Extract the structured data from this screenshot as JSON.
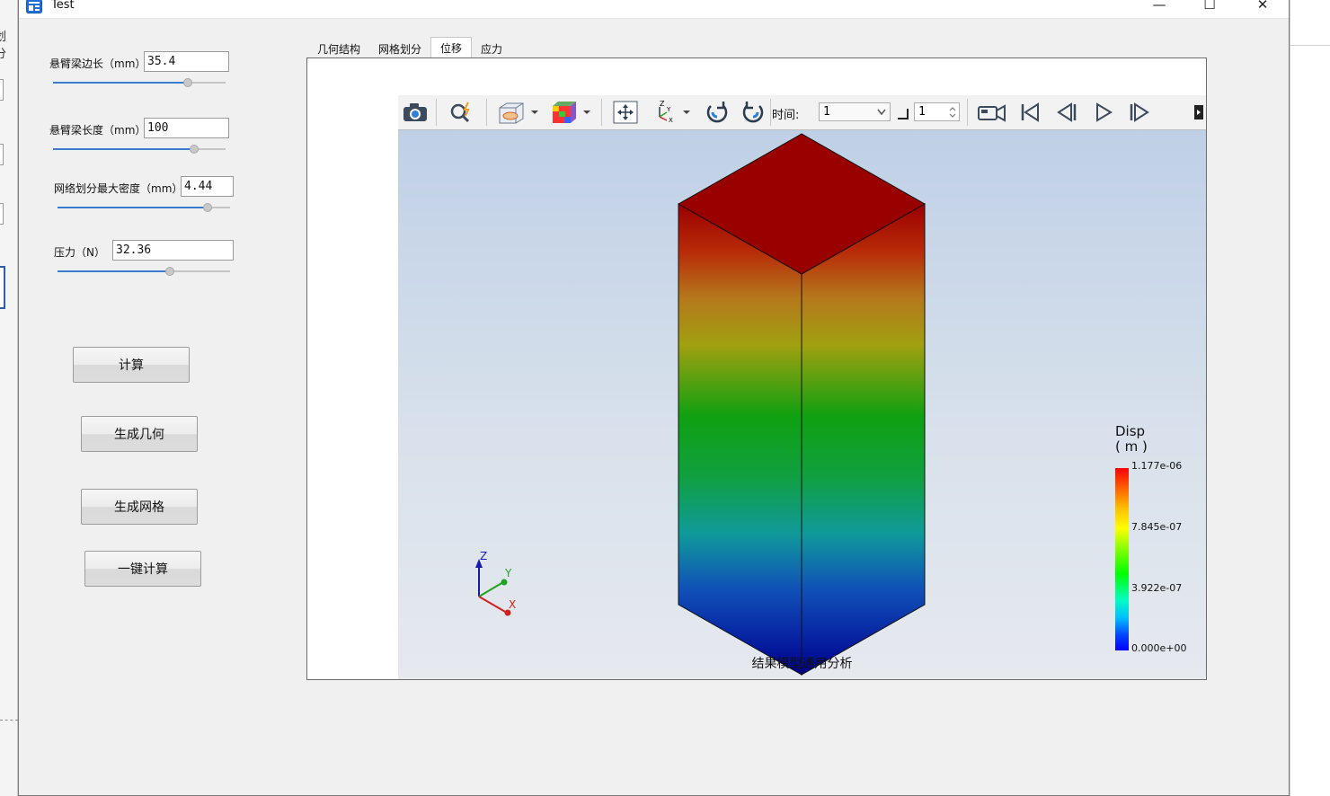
{
  "window": {
    "title": "Test",
    "controls": {
      "minimize": "—",
      "maximize": "☐",
      "close": "✕"
    }
  },
  "background_app": {
    "partial_text": "划分"
  },
  "params": [
    {
      "label": "悬臂梁边长（mm）",
      "value": "35.4",
      "slider_percent": 78
    },
    {
      "label": "悬臂梁长度（mm）",
      "value": "100",
      "slider_percent": 82
    },
    {
      "label": "网络划分最大密度（mm）",
      "value": "4.44",
      "slider_percent": 87
    },
    {
      "label": "压力（N）",
      "value": "32.36",
      "slider_percent": 65
    }
  ],
  "buttons": {
    "calculate": "计算",
    "gen_geometry": "生成几何",
    "gen_mesh": "生成网格",
    "one_click": "一键计算"
  },
  "tabs": [
    {
      "label": "几何结构",
      "active": false
    },
    {
      "label": "网格划分",
      "active": false
    },
    {
      "label": "位移",
      "active": true
    },
    {
      "label": "应力",
      "active": false
    }
  ],
  "toolbar": {
    "time_label": "时间:",
    "time_value": "1",
    "frame_value": "1",
    "icons": [
      "camera-icon",
      "probe-icon",
      "display-style-icon",
      "color-map-icon",
      "fit-view-icon",
      "axes-view-icon",
      "rotate-cw-icon",
      "rotate-ccw-icon",
      "record-video-icon",
      "first-frame-icon",
      "previous-frame-icon",
      "play-icon",
      "next-frame-icon"
    ]
  },
  "scene": {
    "footer_text": "结果模型通用分析",
    "axis_labels": {
      "x": "X",
      "y": "Y",
      "z": "Z"
    },
    "legend": {
      "title": "Disp",
      "unit": "( m )",
      "ticks": [
        "1.177e-06",
        "7.845e-07",
        "3.922e-07",
        "0.000e+00"
      ]
    }
  },
  "colors": {
    "top_face": "#990000",
    "accent": "#3a7bd0"
  }
}
